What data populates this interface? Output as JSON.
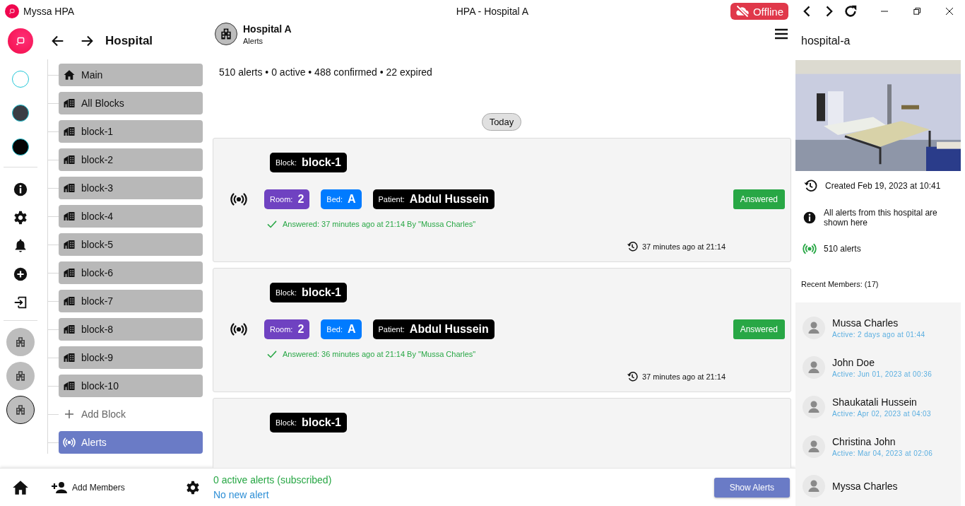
{
  "titlebar": {
    "app_name": "Myssa HPA",
    "title": "HPA - Hospital A",
    "status": "Offline"
  },
  "rail": {
    "spaces": [
      {
        "color": "#ffffff"
      },
      {
        "color": "#3a3d44"
      },
      {
        "color": "#050505"
      }
    ],
    "hospitals": [
      {
        "selected": false
      },
      {
        "selected": false
      },
      {
        "selected": true
      }
    ]
  },
  "nav": {
    "title": "Hospital",
    "items": [
      {
        "kind": "home",
        "label": "Main",
        "selected": false
      },
      {
        "kind": "block",
        "label": "All Blocks",
        "selected": false
      },
      {
        "kind": "block",
        "label": "block-1",
        "selected": false
      },
      {
        "kind": "block",
        "label": "block-2",
        "selected": false
      },
      {
        "kind": "block",
        "label": "block-3",
        "selected": false
      },
      {
        "kind": "block",
        "label": "block-4",
        "selected": false
      },
      {
        "kind": "block",
        "label": "block-5",
        "selected": false
      },
      {
        "kind": "block",
        "label": "block-6",
        "selected": false
      },
      {
        "kind": "block",
        "label": "block-7",
        "selected": false
      },
      {
        "kind": "block",
        "label": "block-8",
        "selected": false
      },
      {
        "kind": "block",
        "label": "block-9",
        "selected": false
      },
      {
        "kind": "block",
        "label": "block-10",
        "selected": false
      },
      {
        "kind": "add",
        "label": "Add Block",
        "selected": false
      },
      {
        "kind": "alerts",
        "label": "Alerts",
        "selected": true
      }
    ]
  },
  "header": {
    "title": "Hospital A",
    "subtitle": "Alerts"
  },
  "stats": "510 alerts • 0 active • 488 confirmed • 22 expired",
  "day": "Today",
  "alerts": [
    {
      "block": {
        "label": "Block:",
        "value": "block-1"
      },
      "tags": [
        {
          "kind": "room",
          "label": "Room:",
          "value": "2"
        },
        {
          "kind": "bed",
          "label": "Bed:",
          "value": "A"
        },
        {
          "kind": "patient",
          "label": "Patient:",
          "value": "Abdul Hussein"
        }
      ],
      "status": {
        "kind": "answered",
        "label": "Answered"
      },
      "answered": "Answered: 37 minutes ago at 21:14 By \"Mussa Charles\"",
      "time": "37 minutes ago at 21:14"
    },
    {
      "block": {
        "label": "Block:",
        "value": "block-1"
      },
      "tags": [
        {
          "kind": "room",
          "label": "Room:",
          "value": "2"
        },
        {
          "kind": "bed",
          "label": "Bed:",
          "value": "A"
        },
        {
          "kind": "patient",
          "label": "Patient:",
          "value": "Abdul Hussein"
        }
      ],
      "status": {
        "kind": "answered",
        "label": "Answered"
      },
      "answered": "Answered: 36 minutes ago at 21:14 By \"Mussa Charles\"",
      "time": "37 minutes ago at 21:14"
    },
    {
      "block": {
        "label": "Block:",
        "value": "block-1"
      }
    }
  ],
  "bottom_bar": {
    "add_members": "Add Members",
    "subscribed": "0 active alerts (subscribed)",
    "new_alert": "No new alert",
    "show_button": "Show Alerts"
  },
  "panel": {
    "slug": "hospital-a",
    "created": "Created Feb 19, 2023 at 10:41",
    "info": "All alerts from this hospital are shown here",
    "count": "510 alerts",
    "members_heading": "Recent Members: (17)",
    "members": [
      {
        "name": "Mussa Charles",
        "active": "Active: 2 days ago at 01:44"
      },
      {
        "name": "John Doe",
        "active": "Active: Jun 01, 2023 at 00:36"
      },
      {
        "name": "Shaukatali Hussein",
        "active": "Active: Apr 02, 2023 at 04:03"
      },
      {
        "name": "Christina John",
        "active": "Active: Mar 04, 2023 at 02:06"
      },
      {
        "name": "Myssa Charles"
      }
    ]
  }
}
